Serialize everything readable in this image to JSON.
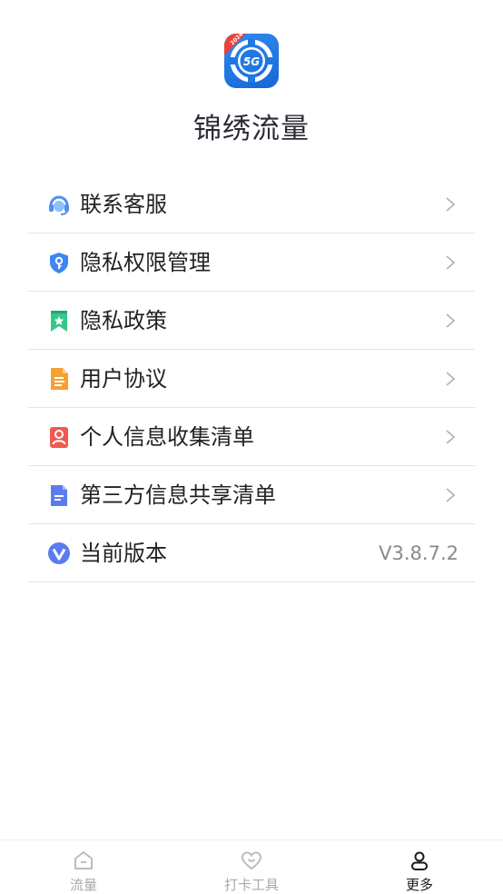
{
  "app": {
    "title": "锦绣流量",
    "logo_text": "5G",
    "logo_badge": "2024"
  },
  "menu": [
    {
      "label": "联系客服",
      "icon": "headset-icon",
      "color": "#4a90f0"
    },
    {
      "label": "隐私权限管理",
      "icon": "shield-key-icon",
      "color": "#3d86f2"
    },
    {
      "label": "隐私政策",
      "icon": "bookmark-star-icon",
      "color": "#34c78a"
    },
    {
      "label": "用户协议",
      "icon": "document-icon",
      "color": "#f5a033"
    },
    {
      "label": "个人信息收集清单",
      "icon": "person-card-icon",
      "color": "#f0594f"
    },
    {
      "label": "第三方信息共享清单",
      "icon": "file-icon",
      "color": "#5b7cf0"
    },
    {
      "label": "当前版本",
      "icon": "version-v-icon",
      "color": "#5b7cf0",
      "value": "V3.8.7.2"
    }
  ],
  "tabs": [
    {
      "label": "流量",
      "icon": "home-icon",
      "active": false
    },
    {
      "label": "打卡工具",
      "icon": "heart-icon",
      "active": false
    },
    {
      "label": "更多",
      "icon": "user-icon",
      "active": true
    }
  ]
}
